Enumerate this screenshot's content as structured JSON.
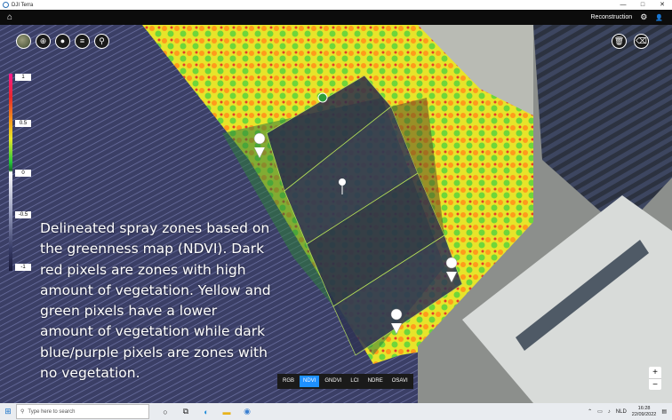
{
  "window": {
    "title": "DJI Terra",
    "minimize": "—",
    "maximize": "□",
    "close": "✕"
  },
  "header": {
    "home_icon": "⌂",
    "mode": "Reconstruction",
    "settings_icon": "⚙",
    "user_icon": "👤"
  },
  "map_tools": {
    "left": [
      {
        "name": "globe",
        "glyph": ""
      },
      {
        "name": "crosshair",
        "glyph": "⊕"
      },
      {
        "name": "pin",
        "glyph": "●"
      },
      {
        "name": "list",
        "glyph": "≡"
      },
      {
        "name": "search",
        "glyph": "⚲"
      }
    ],
    "right": [
      {
        "name": "trash",
        "glyph": "🗑"
      },
      {
        "name": "eraser",
        "glyph": "⌫"
      }
    ]
  },
  "legend": {
    "labels": [
      "1",
      "0.5",
      "0",
      "-0.5",
      "-1"
    ]
  },
  "caption": "Delineated spray zones based on the greenness map (NDVI). Dark red pixels are zones with high amount of vegetation. Yellow and green pixels have a lower amount of vegetation while dark blue/purple pixels are zones with no vegetation.",
  "indices": {
    "items": [
      "RGB",
      "NDVI",
      "GNDVI",
      "LCI",
      "NDRE",
      "OSAVI"
    ],
    "active": "NDVI"
  },
  "zoom": {
    "in": "+",
    "out": "−"
  },
  "taskbar": {
    "start_icon": "⊞",
    "search_placeholder": "Type here to search",
    "language": "NLD",
    "time": "16:28",
    "date": "22/09/2022"
  },
  "colors": {
    "accent": "#1e90ff",
    "appbar": "#0c0c0c"
  }
}
